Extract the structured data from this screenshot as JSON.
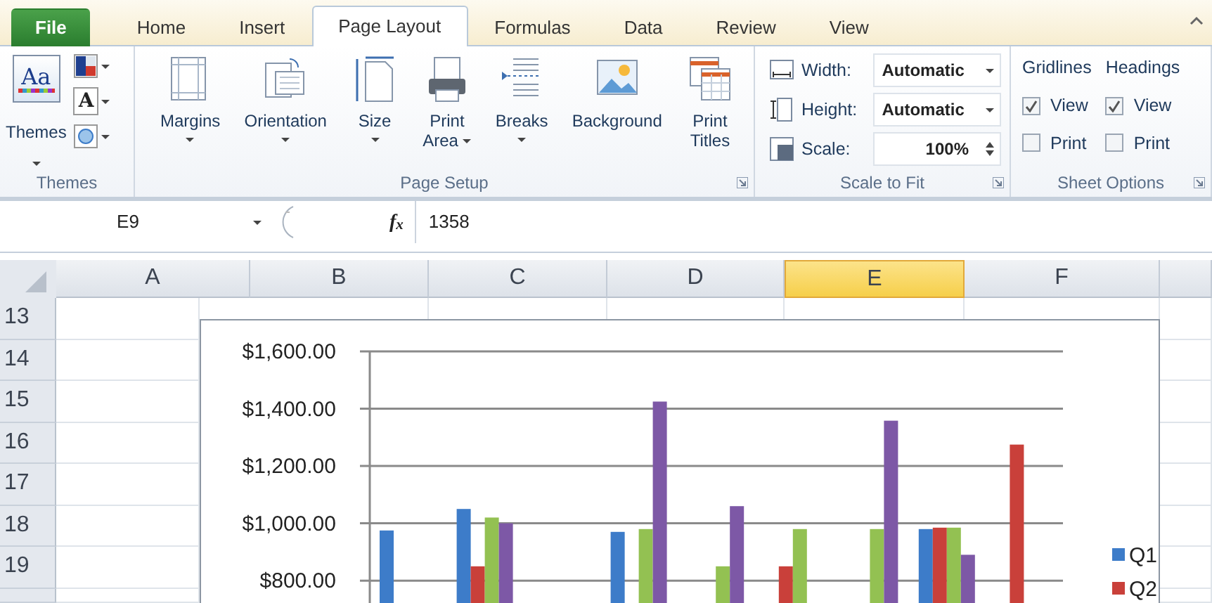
{
  "tabs": [
    {
      "label": "File",
      "kind": "file",
      "selected": false
    },
    {
      "label": "Home",
      "kind": "tab",
      "selected": false
    },
    {
      "label": "Insert",
      "kind": "tab",
      "selected": false
    },
    {
      "label": "Page Layout",
      "kind": "tab",
      "selected": true
    },
    {
      "label": "Formulas",
      "kind": "tab",
      "selected": false
    },
    {
      "label": "Data",
      "kind": "tab",
      "selected": false
    },
    {
      "label": "Review",
      "kind": "tab",
      "selected": false
    },
    {
      "label": "View",
      "kind": "tab",
      "selected": false
    }
  ],
  "themes_group": {
    "label": "Themes",
    "button": {
      "label": "Themes",
      "glyph": "Aa"
    },
    "small_buttons": [
      {
        "kind": "colors"
      },
      {
        "kind": "fonts",
        "glyph": "A"
      },
      {
        "kind": "effects"
      }
    ]
  },
  "page_setup": {
    "label": "Page Setup",
    "buttons": [
      {
        "kind": "margins",
        "lines": [
          "Margins"
        ],
        "dropdown": true
      },
      {
        "kind": "orientation",
        "lines": [
          "Orientation"
        ],
        "dropdown": true
      },
      {
        "kind": "size",
        "lines": [
          "Size"
        ],
        "dropdown": true
      },
      {
        "kind": "print_area",
        "lines": [
          "Print",
          "Area"
        ],
        "dropdown": true
      },
      {
        "kind": "breaks",
        "lines": [
          "Breaks"
        ],
        "dropdown": true
      },
      {
        "kind": "background",
        "lines": [
          "Background"
        ],
        "dropdown": false
      },
      {
        "kind": "print_titles",
        "lines": [
          "Print",
          "Titles"
        ],
        "dropdown": false
      }
    ]
  },
  "scale_to_fit": {
    "label": "Scale to Fit",
    "fields": [
      {
        "kind": "dropdown",
        "label": "Width:",
        "value": "Automatic"
      },
      {
        "kind": "dropdown",
        "label": "Height:",
        "value": "Automatic"
      },
      {
        "kind": "spinner",
        "label": "Scale:",
        "value": "100%"
      }
    ]
  },
  "sheet_options": {
    "label": "Sheet Options",
    "columns": [
      {
        "heading": "Gridlines",
        "options": [
          {
            "label": "View",
            "checked": true
          },
          {
            "label": "Print",
            "checked": false
          }
        ]
      },
      {
        "heading": "Headings",
        "options": [
          {
            "label": "View",
            "checked": true
          },
          {
            "label": "Print",
            "checked": false
          }
        ]
      }
    ]
  },
  "formula_bar": {
    "name_box": "E9",
    "fx": "f$_{x}$",
    "value": "1358"
  },
  "sheet": {
    "columns": [
      {
        "label": "A",
        "selected": false
      },
      {
        "label": "B",
        "selected": false
      },
      {
        "label": "C",
        "selected": false
      },
      {
        "label": "D",
        "selected": false
      },
      {
        "label": "E",
        "selected": true
      },
      {
        "label": "F",
        "selected": false
      }
    ],
    "rows": [
      "13",
      "14",
      "15",
      "16",
      "17",
      "18",
      "19"
    ]
  },
  "chart": {
    "chart_data": {
      "type": "bar",
      "stacked": false,
      "grid": true,
      "legend": true,
      "ylim": [
        717,
        1600
      ],
      "yticks": [
        {
          "value": 800,
          "label": "$800.00"
        },
        {
          "value": 1000,
          "label": "$1,000.00"
        },
        {
          "value": 1200,
          "label": "$1,200.00"
        },
        {
          "value": 1400,
          "label": "$1,400.00"
        },
        {
          "value": 1600,
          "label": "$1,600.00"
        }
      ],
      "series": [
        {
          "name": "Q1",
          "color": "#3d7cc9",
          "values": [
            975,
            1050,
            null,
            970,
            null,
            null,
            null,
            980,
            null
          ]
        },
        {
          "name": "Q2",
          "color": "#c9403a",
          "values": [
            null,
            850,
            null,
            null,
            null,
            850,
            null,
            985,
            1275
          ]
        },
        {
          "color": "#93c152",
          "values": [
            null,
            1020,
            null,
            980,
            850,
            980,
            980,
            985,
            null
          ]
        },
        {
          "color": "#7d58a6",
          "values": [
            null,
            1000,
            null,
            1425,
            1060,
            null,
            1358,
            890,
            null
          ]
        }
      ]
    }
  }
}
